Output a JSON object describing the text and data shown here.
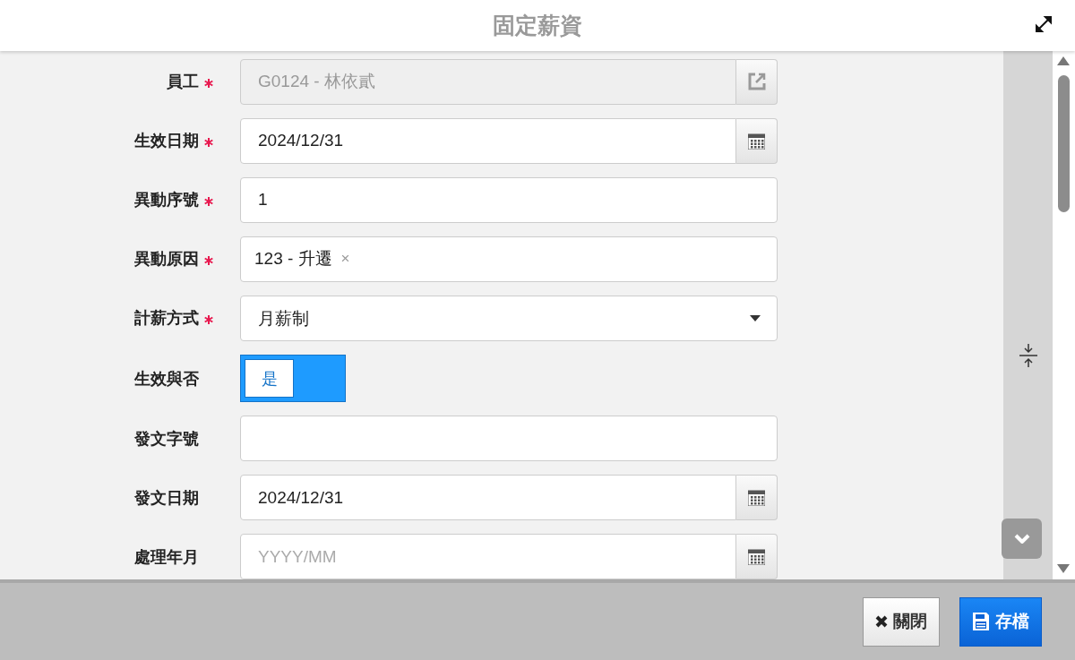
{
  "dialog": {
    "title": "固定薪資"
  },
  "fields": [
    {
      "label": "員工",
      "required": true,
      "kind": "lookup",
      "value": "G0124 - 林依貳",
      "disabled": true
    },
    {
      "label": "生效日期",
      "required": true,
      "kind": "date",
      "value": "2024/12/31"
    },
    {
      "label": "異動序號",
      "required": true,
      "kind": "text",
      "value": "1"
    },
    {
      "label": "異動原因",
      "required": true,
      "kind": "tag",
      "value": "123 - 升遷",
      "remove": "×"
    },
    {
      "label": "計薪方式",
      "required": true,
      "kind": "select",
      "value": "月薪制"
    },
    {
      "label": "生效與否",
      "required": false,
      "kind": "toggle",
      "value": "是",
      "on": true
    },
    {
      "label": "發文字號",
      "required": false,
      "kind": "text"
    },
    {
      "label": "發文日期",
      "required": false,
      "kind": "date",
      "value": "2024/12/31"
    },
    {
      "label": "處理年月",
      "required": false,
      "kind": "date",
      "placeholder": "YYYY/MM"
    }
  ],
  "buttons": [
    {
      "kind": "close",
      "label": "關閉"
    },
    {
      "kind": "save",
      "label": "存檔"
    }
  ]
}
